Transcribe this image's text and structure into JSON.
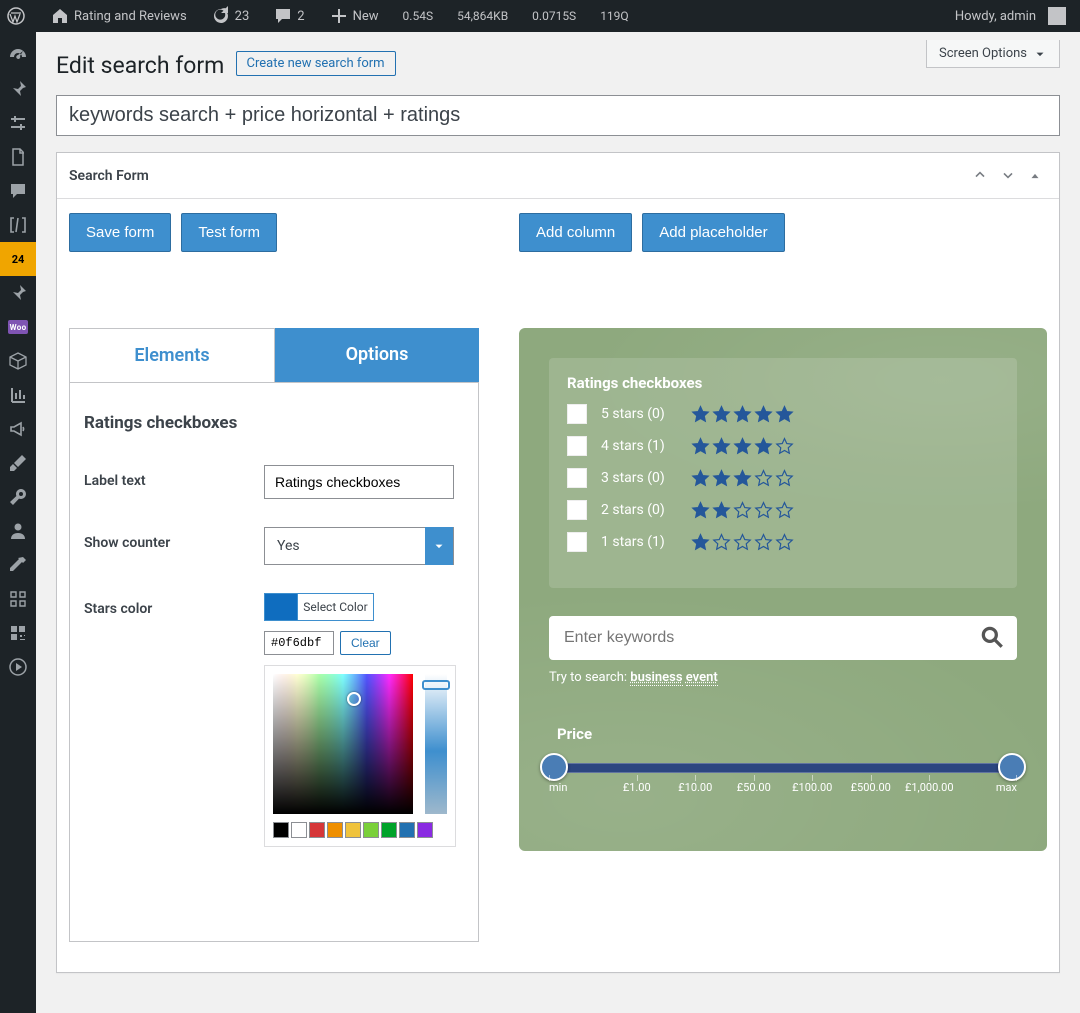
{
  "adminbar": {
    "site_title": "Rating and Reviews",
    "updates": "23",
    "comments": "2",
    "new_label": "New",
    "stat_time": "0.54S",
    "stat_mem": "54,864KB",
    "stat_other": "0.0715S",
    "stat_q": "119Q",
    "howdy": "Howdy, admin"
  },
  "sidemenu": {
    "active_badge": "24",
    "woo_label": "Woo"
  },
  "page": {
    "title": "Edit search form",
    "create_link": "Create new search form",
    "form_name": "keywords search + price horizontal + ratings",
    "screen_options": "Screen Options"
  },
  "panel": {
    "title": "Search Form",
    "save": "Save form",
    "test": "Test form",
    "add_column": "Add column",
    "add_placeholder": "Add placeholder",
    "tab_elements": "Elements",
    "tab_options": "Options"
  },
  "options": {
    "section_title": "Ratings checkboxes",
    "label_text_lbl": "Label text",
    "label_text_val": "Ratings checkboxes",
    "show_counter_lbl": "Show counter",
    "show_counter_val": "Yes",
    "stars_color_lbl": "Stars color",
    "select_color": "Select Color",
    "hex": "#0f6dbf",
    "clear": "Clear"
  },
  "preview": {
    "ratings_title": "Ratings checkboxes",
    "rows": [
      {
        "label": "5 stars (0)",
        "full": 5
      },
      {
        "label": "4 stars (1)",
        "full": 4
      },
      {
        "label": "3 stars (0)",
        "full": 3
      },
      {
        "label": "2 stars (0)",
        "full": 2
      },
      {
        "label": "1 stars (1)",
        "full": 1
      }
    ],
    "kw_placeholder": "Enter keywords",
    "try_prefix": "Try to search: ",
    "try_kw_1": "business",
    "try_kw_2": "event",
    "price_title": "Price",
    "ticks": [
      "min",
      "£1.00",
      "£10.00",
      "£50.00",
      "£100.00",
      "£500.00",
      "£1,000.00",
      "max"
    ]
  },
  "palette": [
    "#000000",
    "#ffffff",
    "#d63638",
    "#ef8f00",
    "#f0c33c",
    "#7ad03a",
    "#00a32a",
    "#2271b1",
    "#8a2be2"
  ],
  "star_color": "#24579a"
}
